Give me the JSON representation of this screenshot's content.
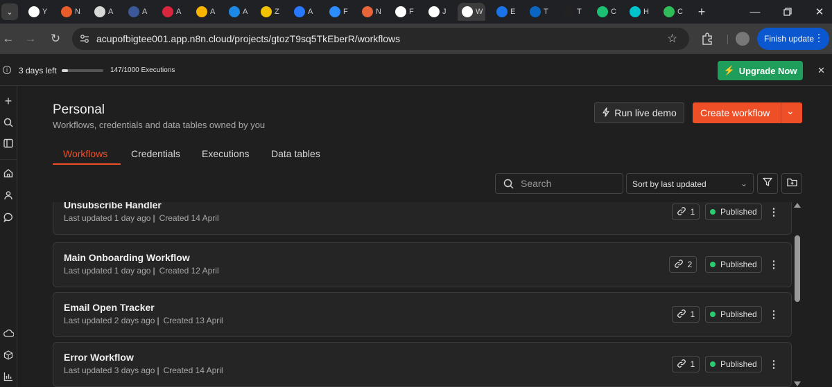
{
  "browser": {
    "tabs": [
      {
        "icon": "chatgpt-icon",
        "title": "Y",
        "color": "#ffffff"
      },
      {
        "icon": "generic-orange-icon",
        "title": "N",
        "color": "#e85d2a"
      },
      {
        "icon": "bracket-icon",
        "title": "A",
        "color": "#d8d8d8"
      },
      {
        "icon": "api-icon",
        "title": "A",
        "color": "#3b5998"
      },
      {
        "icon": "a-icon",
        "title": "A",
        "color": "#d7263d"
      },
      {
        "icon": "airtable-icon",
        "title": "A",
        "color": "#f7b500"
      },
      {
        "icon": "circle-blue-icon",
        "title": "A",
        "color": "#1e88e5"
      },
      {
        "icon": "z-icon",
        "title": "Z",
        "color": "#f2c200"
      },
      {
        "icon": "shield-blue-icon",
        "title": "A",
        "color": "#2979ff"
      },
      {
        "icon": "zoom-icon",
        "title": "F",
        "color": "#2d8cff"
      },
      {
        "icon": "burst-icon",
        "title": "N",
        "color": "#e8643a"
      },
      {
        "icon": "chatgpt-icon",
        "title": "F",
        "color": "#ffffff"
      },
      {
        "icon": "asterisk-icon",
        "title": "J",
        "color": "#ffffff"
      },
      {
        "icon": "n8n-icon",
        "title": "W",
        "color": "#ffffff"
      },
      {
        "icon": "contact-icon",
        "title": "E",
        "color": "#1a73e8"
      },
      {
        "icon": "linkedin-icon",
        "title": "T",
        "color": "#0a66c2"
      },
      {
        "icon": "upwork-icon",
        "title": "T",
        "color": "#222222"
      },
      {
        "icon": "fiverr-icon",
        "title": "C",
        "color": "#1dbf73"
      },
      {
        "icon": "canva-icon",
        "title": "H",
        "color": "#00c4cc"
      },
      {
        "icon": "gy-icon",
        "title": "C",
        "color": "#2ebd59"
      }
    ],
    "url": "acupofbigtee001.app.n8n.cloud/projects/gtozT9sq5TkEberR/workflows",
    "finish_update": "Finish update"
  },
  "banner": {
    "trial_left": "3 days left",
    "executions": "147/1000 Executions",
    "executions_used": 147,
    "executions_total": 1000,
    "upgrade_label": "Upgrade Now"
  },
  "header": {
    "title": "Personal",
    "subtitle": "Workflows, credentials and data tables owned by you",
    "run_demo_label": "Run live demo",
    "create_label": "Create workflow"
  },
  "tabs": [
    {
      "label": "Workflows",
      "active": true
    },
    {
      "label": "Credentials",
      "active": false
    },
    {
      "label": "Executions",
      "active": false
    },
    {
      "label": "Data tables",
      "active": false
    }
  ],
  "filters": {
    "search_placeholder": "Search",
    "sort_value": "Sort by last updated"
  },
  "workflows": [
    {
      "name": "Unsubscribe Handler",
      "updated": "Last updated 1 day ago",
      "created": "Created 14 April",
      "links": "1",
      "status": "Published"
    },
    {
      "name": "Main Onboarding Workflow",
      "updated": "Last updated 1 day ago",
      "created": "Created 12 April",
      "links": "2",
      "status": "Published"
    },
    {
      "name": "Email Open Tracker",
      "updated": "Last updated 2 days ago",
      "created": "Created 13 April",
      "links": "1",
      "status": "Published"
    },
    {
      "name": "Error Workflow",
      "updated": "Last updated 3 days ago",
      "created": "Created 14 April",
      "links": "1",
      "status": "Published"
    }
  ],
  "colors": {
    "accent": "#ee4f27",
    "upgrade_green": "#1e9e5a",
    "published_dot": "#2ecc71",
    "chrome_blue": "#0b57d0"
  }
}
